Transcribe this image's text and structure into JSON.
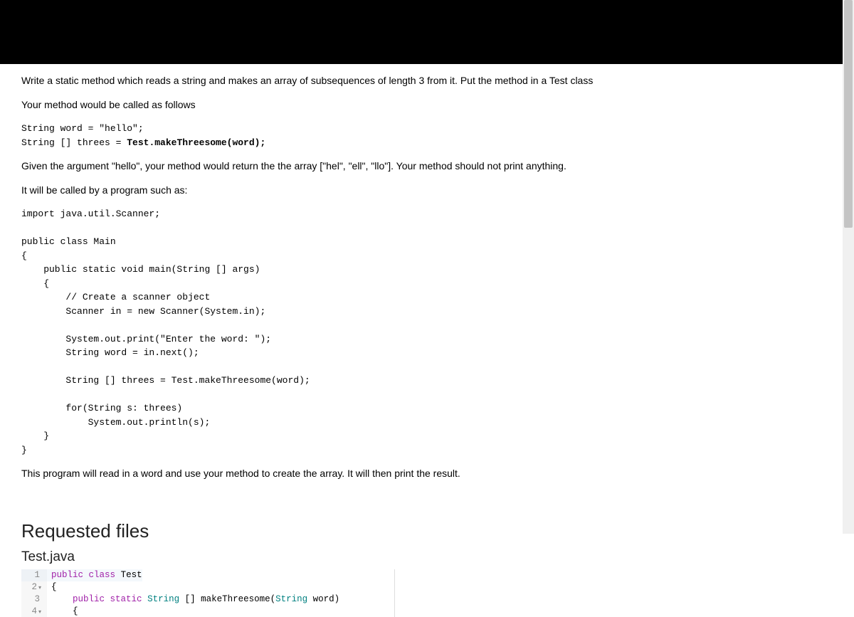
{
  "problem": {
    "p1": "Write a static method which reads a string and makes an array of subsequences of length 3 from it. Put the method in a Test class",
    "p2": "Your method would be called as follows",
    "callExample": {
      "line1": "String word = \"hello\";",
      "line2_pre": "String [] threes = ",
      "line2_bold": "Test.makeThreesome(word);"
    },
    "p3": "Given the argument \"hello\", your method would return the the array [\"hel\", \"ell\", \"llo\"]. Your method should not print anything.",
    "p4": "It will be called by a program such as:",
    "mainProgram": "import java.util.Scanner;\n\npublic class Main\n{\n    public static void main(String [] args)\n    {\n        // Create a scanner object\n        Scanner in = new Scanner(System.in);\n\n        System.out.print(\"Enter the word: \");\n        String word = in.next();\n\n        String [] threes = Test.makeThreesome(word);\n\n        for(String s: threes)\n            System.out.println(s);\n    }\n}",
    "p5": "This program will read in a word and use your method to create the array. It will then print the result."
  },
  "requested": {
    "heading": "Requested files",
    "filename": "Test.java",
    "editor": {
      "lines": [
        {
          "n": "1",
          "fold": "",
          "tokens": [
            [
              "kw",
              "public"
            ],
            [
              "",
              " "
            ],
            [
              "kw",
              "class"
            ],
            [
              "",
              " "
            ],
            [
              "ident",
              "Test"
            ]
          ]
        },
        {
          "n": "2",
          "fold": "▾",
          "tokens": [
            [
              "brace",
              "{"
            ]
          ]
        },
        {
          "n": "3",
          "fold": "",
          "tokens": [
            [
              "",
              "    "
            ],
            [
              "kw",
              "public"
            ],
            [
              "",
              " "
            ],
            [
              "kw",
              "static"
            ],
            [
              "",
              " "
            ],
            [
              "type",
              "String"
            ],
            [
              "",
              " [] makeThreesome("
            ],
            [
              "type",
              "String"
            ],
            [
              "",
              " word)"
            ]
          ]
        },
        {
          "n": "4",
          "fold": "▾",
          "tokens": [
            [
              "",
              "    "
            ],
            [
              "brace",
              "{"
            ]
          ]
        }
      ]
    }
  }
}
